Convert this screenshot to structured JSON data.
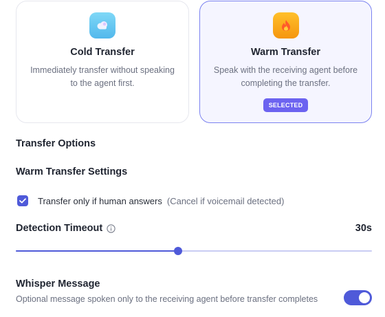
{
  "transfer_types": {
    "cold": {
      "icon": "cloud-icon",
      "title": "Cold Transfer",
      "description": "Immediately transfer without speaking to the agent first."
    },
    "warm": {
      "icon": "flame-icon",
      "title": "Warm Transfer",
      "description": "Speak with the receiving agent before completing the transfer.",
      "selected_label": "SELECTED"
    }
  },
  "sections": {
    "transfer_options": "Transfer Options",
    "warm_settings": "Warm Transfer Settings"
  },
  "human_answer_check": {
    "label": "Transfer only if human answers",
    "hint": "(Cancel if voicemail detected)",
    "checked": true
  },
  "detection_timeout": {
    "label": "Detection Timeout",
    "value_label": "30s",
    "slider_fraction": 0.455
  },
  "whisper": {
    "title": "Whisper Message",
    "description": "Optional message spoken only to the receiving agent before transfer completes",
    "enabled": true
  },
  "colors": {
    "accent": "#4f5ad9",
    "selected_pill": "#6c63f0",
    "selected_border": "#7b82f0"
  }
}
